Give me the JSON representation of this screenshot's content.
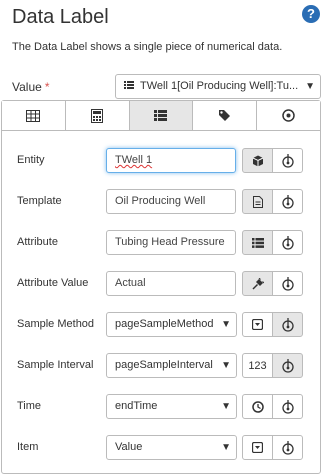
{
  "header": {
    "title": "Data Label",
    "help_icon": "question-circle-icon",
    "description": "The Data Label shows a single piece of numerical data."
  },
  "value_field": {
    "label": "Value",
    "required_mark": "*",
    "selected": "TWell 1[Oil Producing Well]:Tu..."
  },
  "tabs": [
    {
      "icon": "table-icon"
    },
    {
      "icon": "calculator-icon"
    },
    {
      "icon": "list-icon",
      "active": true
    },
    {
      "icon": "tag-icon"
    },
    {
      "icon": "target-icon"
    }
  ],
  "fields": {
    "entity": {
      "label": "Entity",
      "value": "TWell 1"
    },
    "template": {
      "label": "Template",
      "value": "Oil Producing Well"
    },
    "attribute": {
      "label": "Attribute",
      "value": "Tubing Head Pressure"
    },
    "attribute_value": {
      "label": "Attribute Value",
      "value": "Actual"
    },
    "sample_method": {
      "label": "Sample Method",
      "value": "pageSampleMethod"
    },
    "sample_interval": {
      "label": "Sample Interval",
      "value": "pageSampleInterval",
      "button_text": "123"
    },
    "time": {
      "label": "Time",
      "value": "endTime"
    },
    "item": {
      "label": "Item",
      "value": "Value"
    }
  }
}
